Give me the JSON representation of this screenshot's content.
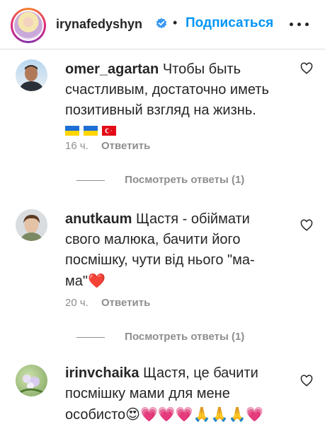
{
  "header": {
    "username": "irynafedyshyn",
    "separator": "•",
    "follow_label": "Подписаться"
  },
  "comments": [
    {
      "username": "omer_agartan",
      "text": "Чтобы быть счастливым, достаточно иметь позитивный взгляд на жизнь.",
      "time": "16 ч.",
      "reply_label": "Ответить",
      "view_replies": "Посмотреть ответы (1)"
    },
    {
      "username": "anutkaum",
      "text": "Щастя - обіймати свого малюка, бачити його посмішку, чути від нього \"ма-ма\"",
      "emoji": "❤️",
      "time": "20 ч.",
      "reply_label": "Ответить",
      "view_replies": "Посмотреть ответы (1)"
    },
    {
      "username": "irinvchaika",
      "text": "Щастя, це бачити посмішку мами для мене особисто",
      "emoji": "😍💗💗💗🙏🙏🙏💗"
    }
  ],
  "colors": {
    "accent": "#0095f6",
    "text": "#262626",
    "secondary": "#8e8e8e",
    "heart_red": "#ed4956"
  },
  "icons": [
    "verified-badge-icon",
    "more-options-icon",
    "like-heart-icon",
    "ukraine-flag-icon",
    "turkey-flag-icon"
  ]
}
